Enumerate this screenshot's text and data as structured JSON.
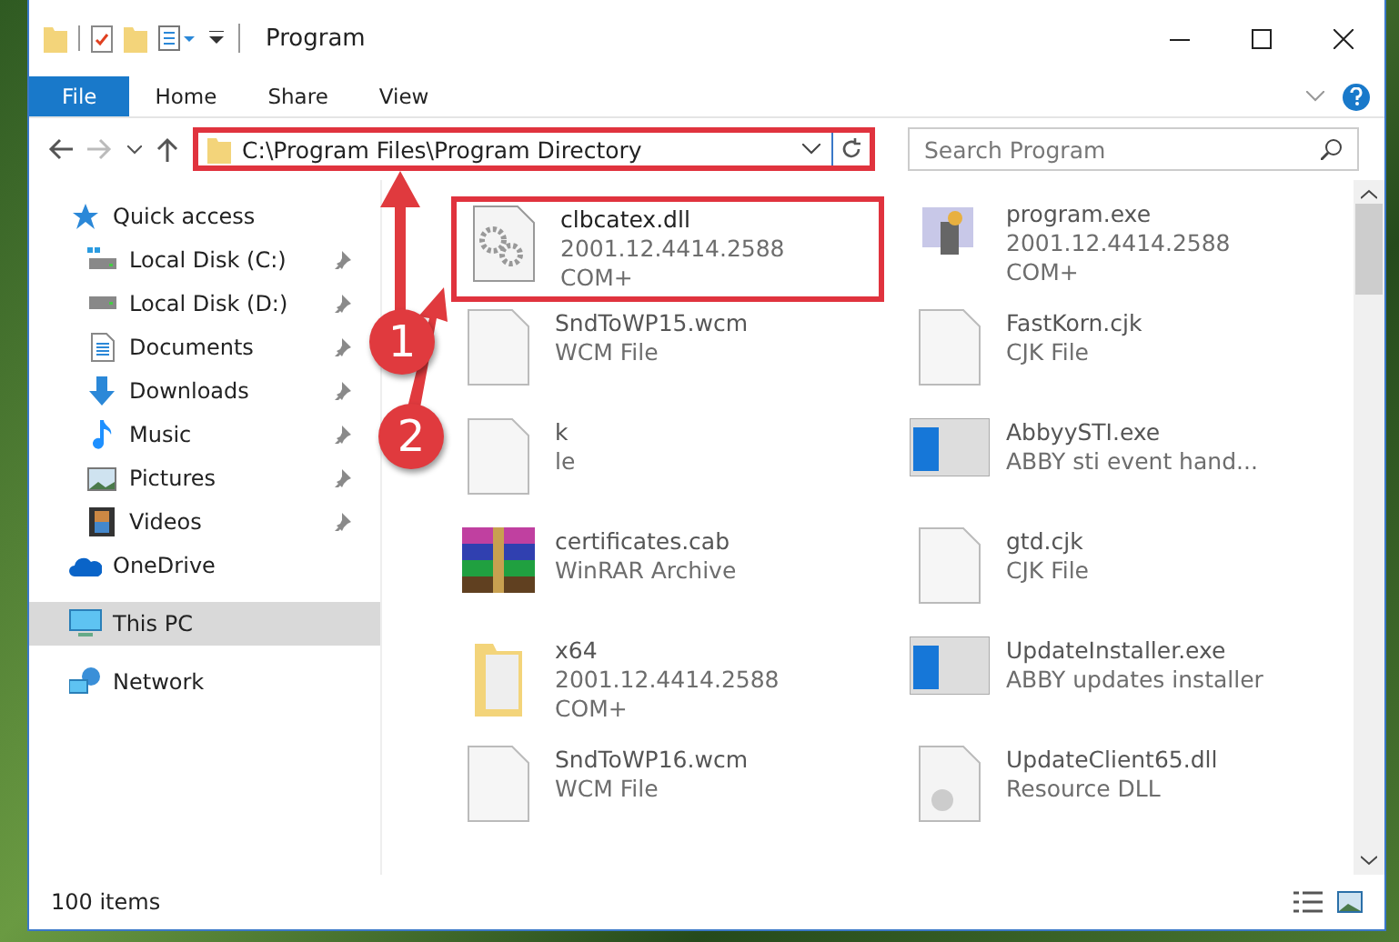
{
  "window": {
    "title": "Program"
  },
  "ribbon_tabs": [
    {
      "label": "File",
      "selected": true
    },
    {
      "label": "Home",
      "selected": false
    },
    {
      "label": "Share",
      "selected": false
    },
    {
      "label": "View",
      "selected": false
    }
  ],
  "address_bar": {
    "path": "C:\\Program Files\\Program Directory",
    "highlighted": true
  },
  "search": {
    "placeholder": "Search Program"
  },
  "sidebar": {
    "items": [
      {
        "label": "Quick access",
        "selected": false,
        "children": [
          {
            "label": "Local Disk (C:)",
            "pinned": true
          },
          {
            "label": "Local Disk (D:)",
            "pinned": true
          },
          {
            "label": "Documents",
            "pinned": true
          },
          {
            "label": "Downloads",
            "pinned": true
          },
          {
            "label": "Music",
            "pinned": true
          },
          {
            "label": "Pictures",
            "pinned": true
          },
          {
            "label": "Videos",
            "pinned": true
          }
        ]
      },
      {
        "label": "OneDrive",
        "selected": false
      },
      {
        "label": "This PC",
        "selected": true
      },
      {
        "label": "Network",
        "selected": false
      }
    ]
  },
  "files": [
    {
      "name": "clbcatex.dll",
      "details": [
        "2001.12.4414.2588",
        "COM+"
      ],
      "kind": "dll",
      "highlighted": true
    },
    {
      "name": "program.exe",
      "details": [
        "2001.12.4414.2588",
        "COM+"
      ],
      "kind": "app",
      "highlighted": false
    },
    {
      "name": "SndToWP15.wcm",
      "details": [
        "WCM File"
      ],
      "kind": "blank",
      "highlighted": false
    },
    {
      "name": "FastKorn.cjk",
      "details": [
        "CJK File"
      ],
      "kind": "blank",
      "highlighted": false
    },
    {
      "name": "k",
      "details": [
        "le"
      ],
      "kind": "blank",
      "highlighted": false
    },
    {
      "name": "AbbyySTI.exe",
      "details": [
        "ABBY sti event hand..."
      ],
      "kind": "window",
      "highlighted": false
    },
    {
      "name": "certificates.cab",
      "details": [
        "WinRAR Archive"
      ],
      "kind": "archive",
      "highlighted": false
    },
    {
      "name": "gtd.cjk",
      "details": [
        "CJK File"
      ],
      "kind": "blank",
      "highlighted": false
    },
    {
      "name": "x64",
      "details": [
        "2001.12.4414.2588",
        "COM+"
      ],
      "kind": "folder",
      "highlighted": false
    },
    {
      "name": "UpdateInstaller.exe",
      "details": [
        "ABBY updates installer"
      ],
      "kind": "window",
      "highlighted": false
    },
    {
      "name": "SndToWP16.wcm",
      "details": [
        "WCM File"
      ],
      "kind": "blank",
      "highlighted": false
    },
    {
      "name": "UpdateClient65.dll",
      "details": [
        "Resource DLL"
      ],
      "kind": "resource",
      "highlighted": false
    }
  ],
  "status_bar": {
    "count": "100 items"
  },
  "callouts": [
    {
      "number": "1"
    },
    {
      "number": "2"
    }
  ]
}
